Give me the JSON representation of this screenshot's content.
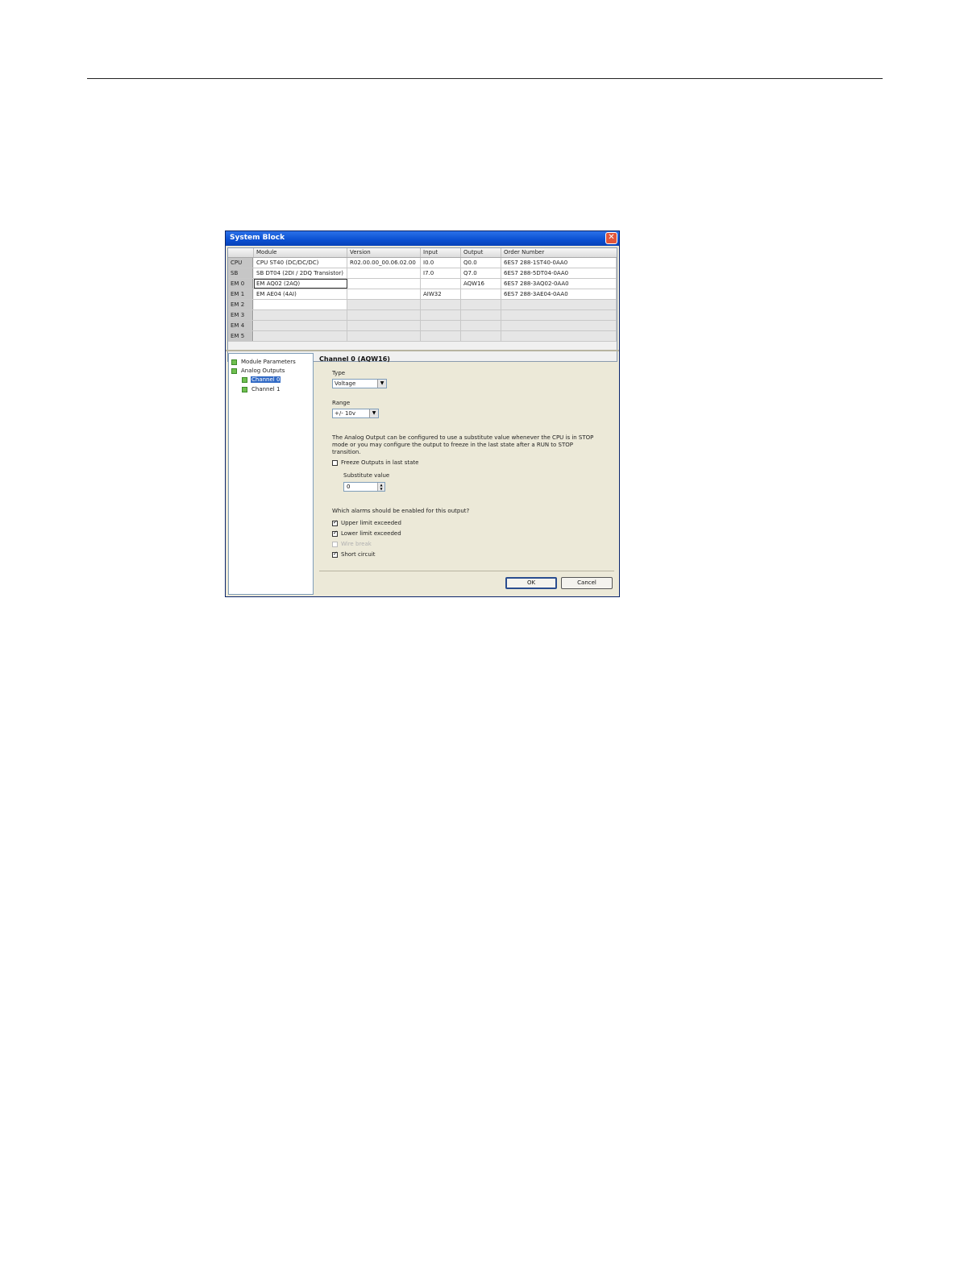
{
  "dialog": {
    "title": "System Block"
  },
  "grid": {
    "headers": [
      "Module",
      "Version",
      "Input",
      "Output",
      "Order Number"
    ],
    "rows": [
      {
        "slot": "CPU",
        "module": "CPU ST40 (DC/DC/DC)",
        "version": "R02.00.00_00.06.02.00",
        "input": "I0.0",
        "output": "Q0.0",
        "order": "6ES7 288-1ST40-0AA0"
      },
      {
        "slot": "SB",
        "module": "SB DT04 (2DI / 2DQ Transistor)",
        "version": "",
        "input": "I7.0",
        "output": "Q7.0",
        "order": "6ES7 288-5DT04-0AA0"
      },
      {
        "slot": "EM 0",
        "module": "EM AQ02 (2AQ)",
        "version": "",
        "input": "",
        "output": "AQW16",
        "order": "6ES7 288-3AQ02-0AA0"
      },
      {
        "slot": "EM 1",
        "module": "EM AE04 (4AI)",
        "version": "",
        "input": "AIW32",
        "output": "",
        "order": "6ES7 288-3AE04-0AA0"
      },
      {
        "slot": "EM 2",
        "module": "",
        "version": "",
        "input": "",
        "output": "",
        "order": ""
      },
      {
        "slot": "EM 3",
        "module": "",
        "version": "",
        "input": "",
        "output": "",
        "order": ""
      },
      {
        "slot": "EM 4",
        "module": "",
        "version": "",
        "input": "",
        "output": "",
        "order": ""
      },
      {
        "slot": "EM 5",
        "module": "",
        "version": "",
        "input": "",
        "output": "",
        "order": ""
      }
    ]
  },
  "tree": {
    "module_parameters": "Module Parameters",
    "analog_outputs": "Analog Outputs",
    "channel0": "Channel 0",
    "channel1": "Channel 1"
  },
  "panel": {
    "title": "Channel 0 (AQW16)",
    "type_label": "Type",
    "type_value": "Voltage",
    "range_label": "Range",
    "range_value": "+/- 10v",
    "description": "The Analog Output can be configured to use a substitute value whenever the CPU is in STOP mode or you may configure the output to freeze in the last state after a RUN to STOP transition.",
    "freeze_label": "Freeze Outputs in last state",
    "substitute_label": "Substitute value",
    "substitute_value": "0",
    "alarms_question": "Which alarms should be enabled for this output?",
    "alarm_upper": "Upper limit exceeded",
    "alarm_lower": "Lower limit exceeded",
    "alarm_wire": "Wire break",
    "alarm_short": "Short circuit"
  },
  "buttons": {
    "ok": "OK",
    "cancel": "Cancel"
  }
}
